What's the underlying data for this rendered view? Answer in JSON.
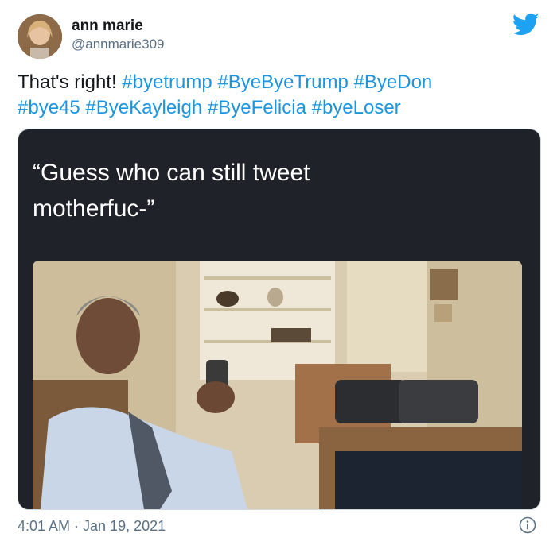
{
  "user": {
    "display_name": "ann marie",
    "handle": "@annmarie309"
  },
  "tweet": {
    "lead_text": "That's right! ",
    "hashtags": [
      "#byetrump",
      "#ByeByeTrump",
      "#ByeDon",
      "#bye45",
      "#ByeKayleigh",
      "#ByeFelicia",
      "#byeLoser"
    ],
    "timestamp": "4:01 AM · Jan 19, 2021"
  },
  "media": {
    "caption_line1": "“Guess who can still tweet",
    "caption_line2": "motherfuc-”"
  },
  "icons": {
    "brand": "twitter-bird-icon",
    "info": "info-icon"
  },
  "colors": {
    "brand": "#1da1f2",
    "hashtag": "#1b95e0",
    "muted": "#5b7083",
    "media_bg": "#1f2229"
  }
}
